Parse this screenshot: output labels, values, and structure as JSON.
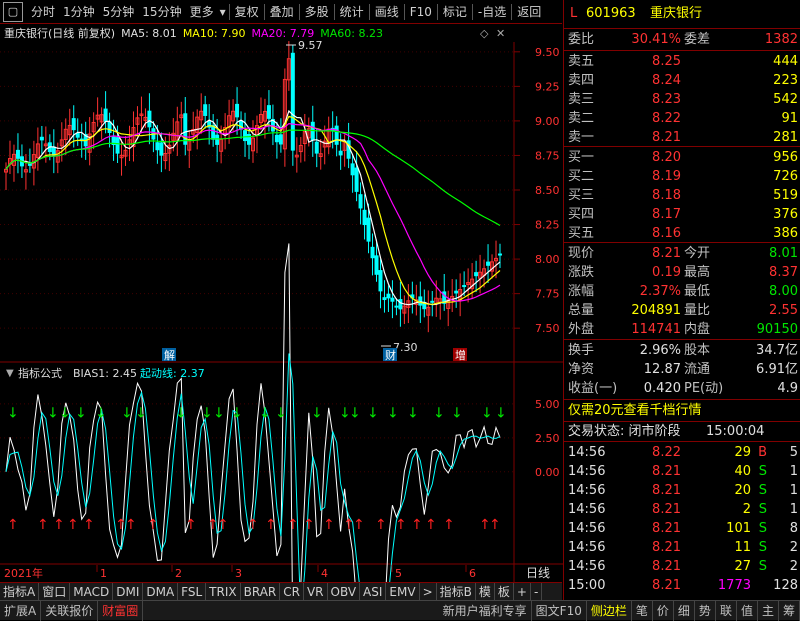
{
  "toolbar": {
    "items": [
      "分时",
      "1分钟",
      "5分钟",
      "15分钟",
      "更多",
      "复权",
      "叠加",
      "多股",
      "统计",
      "画线",
      "F10",
      "标记",
      "-自选",
      "返回"
    ]
  },
  "chart": {
    "title": "重庆银行(日线 前复权)",
    "ma5": "MA5: 8.01",
    "ma10": "MA10: 7.90",
    "ma20": "MA20: 7.79",
    "ma60": "MA60: 8.23",
    "y_ticks": [
      "9.50",
      "9.25",
      "9.00",
      "8.75",
      "8.50",
      "8.25",
      "8.00",
      "7.75",
      "7.50"
    ],
    "high_mark": "9.57",
    "low_mark": "7.30",
    "events": [
      "解",
      "财",
      "增"
    ],
    "colors": {
      "ma5": "#ffffff",
      "ma10": "#ffff00",
      "ma20": "#ff00ff",
      "ma60": "#00ff00",
      "up": "#ff3232",
      "down": "#00ffff"
    }
  },
  "indicator": {
    "title": "指标公式",
    "bias": "BIAS1: 2.45",
    "start": "起动线: 2.37",
    "y_ticks": [
      "5.00",
      "2.50",
      "0.00"
    ]
  },
  "timeline": {
    "year": "2021年",
    "months": [
      "1",
      "2",
      "3",
      "4",
      "5",
      "6"
    ],
    "period": "日线"
  },
  "tabs": [
    "指标A",
    "窗口",
    "MACD",
    "DMI",
    "DMA",
    "FSL",
    "TRIX",
    "BRAR",
    "CR",
    "VR",
    "OBV",
    "ASI",
    "EMV",
    ">",
    "指标B",
    "模",
    "板",
    "+",
    "-"
  ],
  "status": {
    "items": [
      "扩展A",
      "关联报价",
      "财富圈"
    ],
    "right": [
      "新用户福利专享",
      "图文F10",
      "侧边栏"
    ],
    "bottom_tabs": [
      "笔",
      "价",
      "细",
      "势",
      "联",
      "值",
      "主",
      "筹"
    ]
  },
  "quote": {
    "code": "601963",
    "name": "重庆银行",
    "ratio_label": "委比",
    "ratio": "30.41%",
    "diff_label": "委差",
    "diff": "1382",
    "sell": [
      {
        "label": "卖五",
        "price": "8.25",
        "vol": "444"
      },
      {
        "label": "卖四",
        "price": "8.24",
        "vol": "223"
      },
      {
        "label": "卖三",
        "price": "8.23",
        "vol": "542"
      },
      {
        "label": "卖二",
        "price": "8.22",
        "vol": "91"
      },
      {
        "label": "卖一",
        "price": "8.21",
        "vol": "281"
      }
    ],
    "buy": [
      {
        "label": "买一",
        "price": "8.20",
        "vol": "956"
      },
      {
        "label": "买二",
        "price": "8.19",
        "vol": "726"
      },
      {
        "label": "买三",
        "price": "8.18",
        "vol": "519"
      },
      {
        "label": "买四",
        "price": "8.17",
        "vol": "376"
      },
      {
        "label": "买五",
        "price": "8.16",
        "vol": "386"
      }
    ],
    "stats": [
      {
        "l1": "现价",
        "v1": "8.21",
        "c1": "red",
        "l2": "今开",
        "v2": "8.01",
        "c2": "green"
      },
      {
        "l1": "涨跌",
        "v1": "0.19",
        "c1": "red",
        "l2": "最高",
        "v2": "8.37",
        "c2": "red"
      },
      {
        "l1": "涨幅",
        "v1": "2.37%",
        "c1": "red",
        "l2": "最低",
        "v2": "8.00",
        "c2": "green"
      },
      {
        "l1": "总量",
        "v1": "204891",
        "c1": "yellow",
        "l2": "量比",
        "v2": "2.55",
        "c2": "red"
      },
      {
        "l1": "外盘",
        "v1": "114741",
        "c1": "red",
        "l2": "内盘",
        "v2": "90150",
        "c2": "green"
      }
    ],
    "stats2": [
      {
        "l1": "换手",
        "v1": "2.96%",
        "l2": "股本",
        "v2": "34.7亿"
      },
      {
        "l1": "净资",
        "v1": "12.87",
        "l2": "流通",
        "v2": "6.91亿"
      },
      {
        "l1": "收益(一)",
        "v1": "0.420",
        "l2": "PE(动)",
        "v2": "4.9"
      }
    ],
    "promo": "仅需20元查看千档行情",
    "trade_status": "交易状态: 闭市阶段",
    "trade_time": "15:00:04",
    "ticks": [
      {
        "t": "14:56",
        "p": "8.22",
        "v": "29",
        "f": "B",
        "n": "5"
      },
      {
        "t": "14:56",
        "p": "8.21",
        "v": "40",
        "f": "S",
        "n": "1"
      },
      {
        "t": "14:56",
        "p": "8.21",
        "v": "20",
        "f": "S",
        "n": "1"
      },
      {
        "t": "14:56",
        "p": "8.21",
        "v": "2",
        "f": "S",
        "n": "1"
      },
      {
        "t": "14:56",
        "p": "8.21",
        "v": "101",
        "f": "S",
        "n": "8"
      },
      {
        "t": "14:56",
        "p": "8.21",
        "v": "11",
        "f": "S",
        "n": "2"
      },
      {
        "t": "14:56",
        "p": "8.21",
        "v": "27",
        "f": "S",
        "n": "2"
      },
      {
        "t": "15:00",
        "p": "8.21",
        "v": "1773",
        "f": "",
        "n": "128"
      }
    ]
  }
}
